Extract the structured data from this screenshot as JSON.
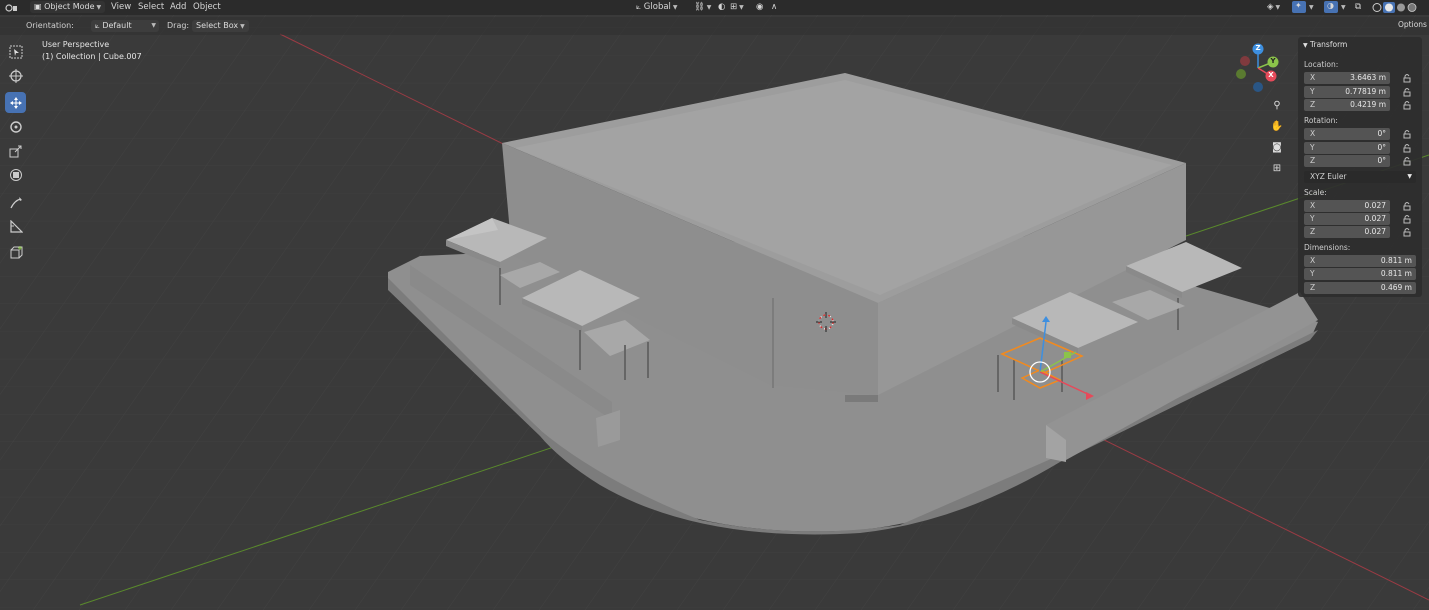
{
  "header": {
    "mode": "Object Mode",
    "menus": [
      "View",
      "Select",
      "Add",
      "Object"
    ],
    "transform_space": "Global",
    "options": "Options"
  },
  "tool_header": {
    "orientation_label": "Orientation:",
    "orientation_value": "Default",
    "drag_label": "Drag:",
    "drag_value": "Select Box"
  },
  "viewport": {
    "perspective": "User Perspective",
    "collection": "(1) Collection | Cube.007"
  },
  "gizmo": {
    "z": "Z",
    "y": "Y",
    "x": "X"
  },
  "transform": {
    "title": "Transform",
    "location_label": "Location:",
    "location": [
      {
        "axis": "X",
        "value": "3.6463 m"
      },
      {
        "axis": "Y",
        "value": "0.77819 m"
      },
      {
        "axis": "Z",
        "value": "0.4219 m"
      }
    ],
    "rotation_label": "Rotation:",
    "rotation": [
      {
        "axis": "X",
        "value": "0°"
      },
      {
        "axis": "Y",
        "value": "0°"
      },
      {
        "axis": "Z",
        "value": "0°"
      }
    ],
    "rotation_mode": "XYZ Euler",
    "scale_label": "Scale:",
    "scale": [
      {
        "axis": "X",
        "value": "0.027"
      },
      {
        "axis": "Y",
        "value": "0.027"
      },
      {
        "axis": "Z",
        "value": "0.027"
      }
    ],
    "dimensions_label": "Dimensions:",
    "dimensions": [
      {
        "axis": "X",
        "value": "0.811 m"
      },
      {
        "axis": "Y",
        "value": "0.811 m"
      },
      {
        "axis": "Z",
        "value": "0.469 m"
      }
    ]
  },
  "colors": {
    "accent": "#4772b3",
    "selection": "#f28a1e",
    "x_axis": "#e64a5a",
    "y_axis": "#8bc34a",
    "z_axis": "#3d8fe0"
  }
}
